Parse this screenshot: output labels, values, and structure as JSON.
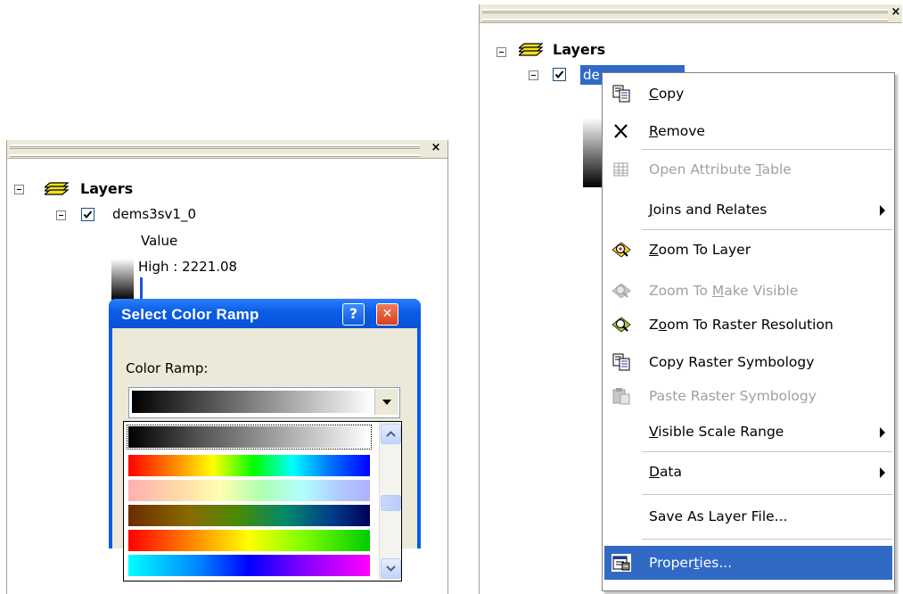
{
  "left_toc": {
    "root_label": "Layers",
    "layer_name": "dems3sv1_0",
    "legend_heading": "Value",
    "legend_high": "High : 2221.08"
  },
  "dialog": {
    "title": "Select Color Ramp",
    "help_glyph": "?",
    "close_glyph": "✕",
    "ramp_label": "Color Ramp:",
    "ramps": [
      "black-white",
      "spectrum",
      "pastel-spectrum",
      "brown-blue",
      "red-green",
      "cyan-magenta"
    ]
  },
  "right_toc": {
    "root_label": "Layers",
    "layer_name_visible": "de"
  },
  "context_menu": {
    "items": [
      {
        "label_pre": "",
        "label_ul": "C",
        "label_post": "opy",
        "enabled": true,
        "icon": "copy-icon"
      },
      {
        "label_pre": "",
        "label_ul": "R",
        "label_post": "emove",
        "enabled": true,
        "icon": "remove-icon"
      },
      {
        "label_pre": "Open Attribute ",
        "label_ul": "T",
        "label_post": "able",
        "enabled": false,
        "icon": "table-icon"
      },
      {
        "label_pre": "",
        "label_ul": "J",
        "label_post": "oins and Relates",
        "enabled": true,
        "icon": "",
        "submenu": true
      },
      {
        "label_pre": "",
        "label_ul": "Z",
        "label_post": "oom To Layer",
        "enabled": true,
        "icon": "zoom-to-layer-icon"
      },
      {
        "label_pre": "Zoom To ",
        "label_ul": "M",
        "label_post": "ake Visible",
        "enabled": false,
        "icon": "zoom-visible-icon"
      },
      {
        "label_pre": "Z",
        "label_ul": "o",
        "label_post": "om To Raster Resolution",
        "enabled": true,
        "icon": "zoom-raster-icon"
      },
      {
        "label_pre": "Copy Raster Symbology",
        "label_ul": "",
        "label_post": "",
        "enabled": true,
        "icon": "copy-symbology-icon"
      },
      {
        "label_pre": "Paste Raster Symbology",
        "label_ul": "",
        "label_post": "",
        "enabled": false,
        "icon": "paste-symbology-icon"
      },
      {
        "label_pre": "",
        "label_ul": "V",
        "label_post": "isible Scale Range",
        "enabled": true,
        "icon": "",
        "submenu": true
      },
      {
        "label_pre": "",
        "label_ul": "D",
        "label_post": "ata",
        "enabled": true,
        "icon": "",
        "submenu": true
      },
      {
        "label_pre": "Save As Layer File...",
        "label_ul": "",
        "label_post": "",
        "enabled": true,
        "icon": ""
      },
      {
        "label_pre": "Proper",
        "label_ul": "t",
        "label_post": "ies...",
        "enabled": true,
        "icon": "properties-icon",
        "highlighted": true
      }
    ]
  },
  "colors": {
    "xp_blue": "#0a5ce6",
    "menu_highlight": "#316ac5",
    "dialog_face": "#ece9d8"
  }
}
